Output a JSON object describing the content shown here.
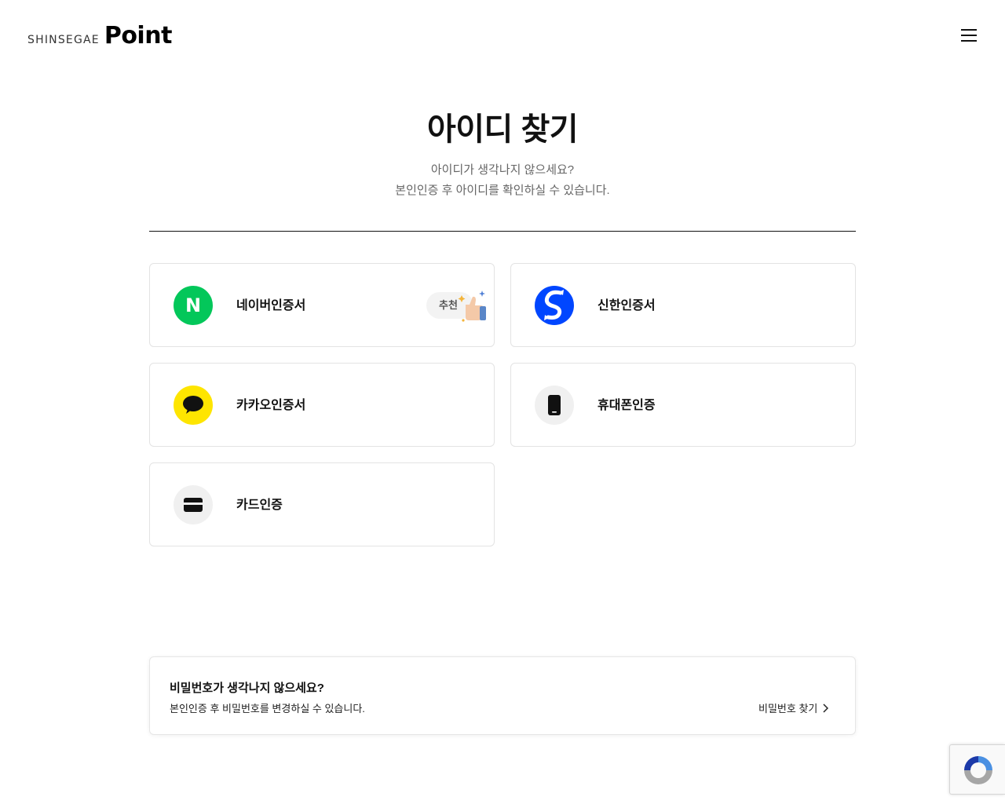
{
  "header": {
    "logo_small": "SHINSEGAE",
    "logo_big": "Point"
  },
  "main": {
    "title": "아이디 찾기",
    "desc_line1": "아이디가 생각나지 않으세요?",
    "desc_line2": "본인인증 후 아이디를 확인하실 수 있습니다."
  },
  "auth_options": [
    {
      "label": "네이버인증서",
      "icon": "naver-icon",
      "badge": "추천"
    },
    {
      "label": "신한인증서",
      "icon": "shinhan-icon"
    },
    {
      "label": "카카오인증서",
      "icon": "kakao-icon"
    },
    {
      "label": "휴대폰인증",
      "icon": "phone-icon"
    },
    {
      "label": "카드인증",
      "icon": "card-icon"
    }
  ],
  "password_box": {
    "title": "비밀번호가 생각나지 않으세요?",
    "subtitle": "본인인증 후 비밀번호를 변경하실 수 있습니다.",
    "link_label": "비밀번호 찾기"
  },
  "colors": {
    "naver": "#03c75a",
    "shinhan": "#0046ff",
    "kakao": "#fee500",
    "divider": "#111111",
    "card_border": "#e3e3e3"
  }
}
